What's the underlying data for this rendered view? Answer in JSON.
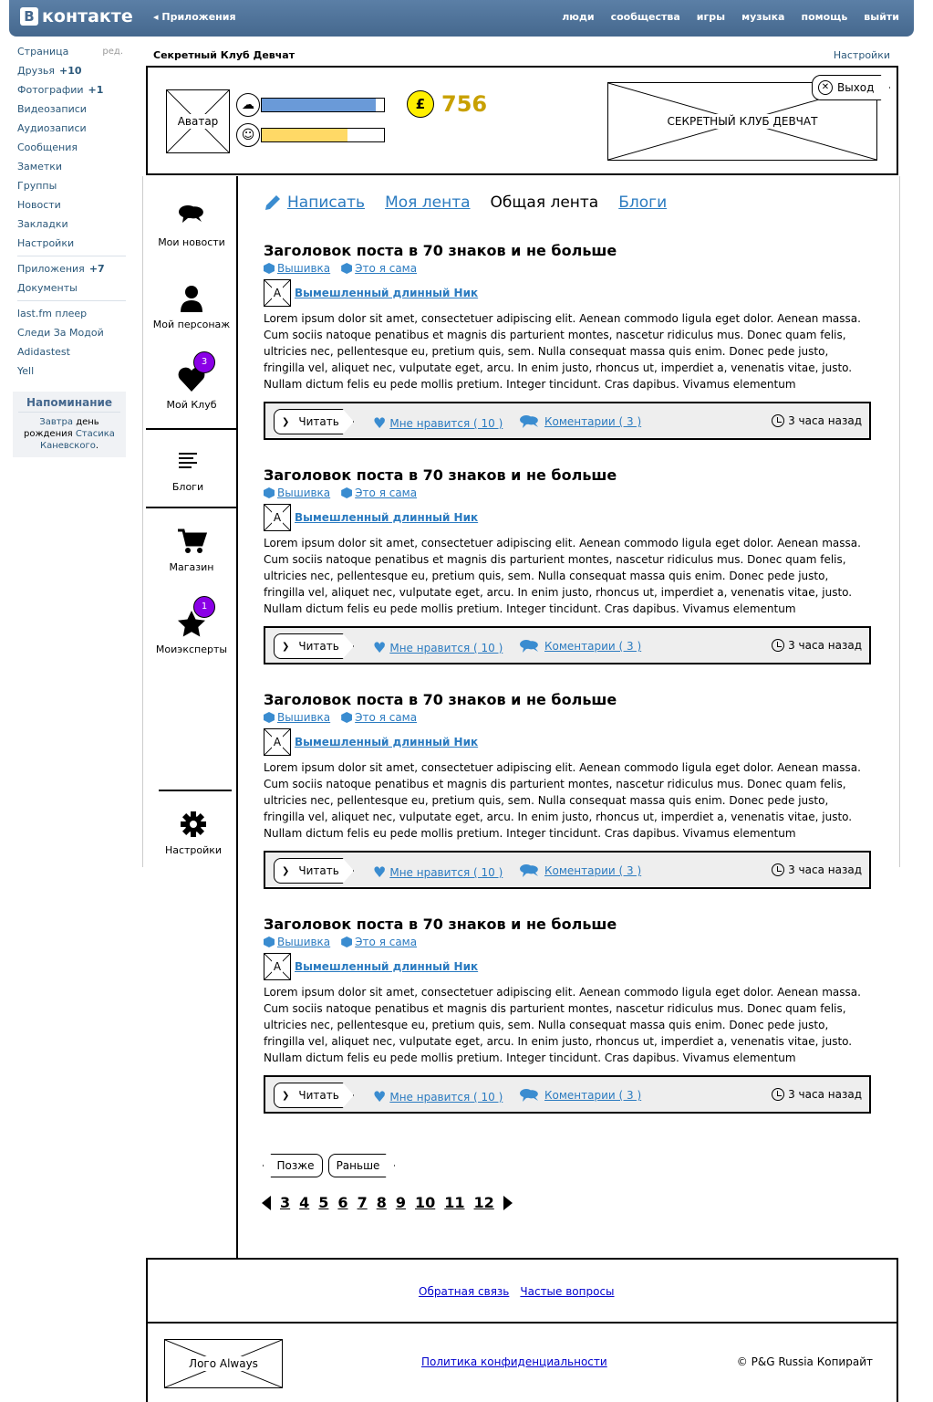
{
  "topbar": {
    "logo_b": "В",
    "logo_text": "контакте",
    "apps_link": "Приложения",
    "nav": [
      "люди",
      "сообщества",
      "игры",
      "музыка",
      "помощь",
      "выйти"
    ]
  },
  "leftmenu": {
    "edit": "ред.",
    "group1": [
      {
        "label": "Страница"
      },
      {
        "label": "Друзья",
        "count": "+10"
      },
      {
        "label": "Фотографии",
        "count": "+1"
      },
      {
        "label": "Видеозаписи"
      },
      {
        "label": "Аудиозаписи"
      },
      {
        "label": "Сообщения"
      },
      {
        "label": "Заметки"
      },
      {
        "label": "Группы"
      },
      {
        "label": "Новости"
      },
      {
        "label": "Закладки"
      },
      {
        "label": "Настройки"
      }
    ],
    "group2": [
      {
        "label": "Приложения",
        "count": "+7"
      },
      {
        "label": "Документы"
      }
    ],
    "group3": [
      {
        "label": "last.fm плеер"
      },
      {
        "label": "Следи За Модой"
      },
      {
        "label": "Adidastest"
      },
      {
        "label": "Yell"
      }
    ],
    "reminder": {
      "title": "Напоминание",
      "tomorrow": "Завтра",
      "text1": " день рождения ",
      "name": "Стасика Каневского",
      "dot": "."
    }
  },
  "header": {
    "title": "Секретный Клуб Девчат",
    "settings": "Настройки"
  },
  "profile": {
    "avatar": "Аватар",
    "bar1_level": 0.93,
    "bar2_level": 0.7,
    "coin_symbol": "£",
    "coins": "756",
    "club_banner": "СЕКРЕТНЫЙ КЛУБ ДЕВЧАТ",
    "exit": "Выход"
  },
  "sidenav": [
    {
      "label": "Мои новости",
      "icon": "chat-bubbles-icon"
    },
    {
      "label": "Мой персонаж",
      "icon": "person-icon"
    },
    {
      "label": "Мой Клуб",
      "icon": "heart-icon",
      "badge": "3"
    },
    {
      "label": "Блоги",
      "icon": "list-icon"
    },
    {
      "label": "Магазин",
      "icon": "cart-icon"
    },
    {
      "label": "Моиэксперты",
      "icon": "star-icon",
      "badge": "1"
    },
    {
      "label": "Настройки",
      "icon": "gear-icon"
    }
  ],
  "tabs": {
    "write": "Написать",
    "my_feed": "Моя лента",
    "common_feed": "Общая лента",
    "blogs": "Блоги"
  },
  "posts": [
    {
      "title": "Заголовок поста в 70 знаков и не больше",
      "tag1": "Вышивка",
      "tag2": "Это я сама",
      "avatar": "A",
      "nick": "Вымешленный длинный Ник",
      "body": "Lorem ipsum dolor sit amet, consectetuer adipiscing elit. Aenean commodo ligula eget dolor. Aenean massa. Cum sociis natoque penatibus et magnis dis parturient montes, nascetur ridiculus mus. Donec quam felis, ultricies nec, pellentesque eu, pretium quis, sem. Nulla consequat massa quis enim. Donec pede justo, fringilla vel, aliquet nec, vulputate eget, arcu. In enim justo, rhoncus ut, imperdiet a, venenatis vitae, justo. Nullam dictum felis eu pede mollis pretium. Integer tincidunt. Cras dapibus. Vivamus elementum",
      "read": "Читать",
      "like": "Мне нравится ( 10 )",
      "comments": "Коментарии ( 3 )",
      "time": "3 часа назад"
    },
    {
      "title": "Заголовок поста в 70 знаков и не больше",
      "tag1": "Вышивка",
      "tag2": "Это я сама",
      "avatar": "A",
      "nick": "Вымешленный длинный Ник",
      "body": "Lorem ipsum dolor sit amet, consectetuer adipiscing elit. Aenean commodo ligula eget dolor. Aenean massa. Cum sociis natoque penatibus et magnis dis parturient montes, nascetur ridiculus mus. Donec quam felis, ultricies nec, pellentesque eu, pretium quis, sem. Nulla consequat massa quis enim. Donec pede justo, fringilla vel, aliquet nec, vulputate eget, arcu. In enim justo, rhoncus ut, imperdiet a, venenatis vitae, justo. Nullam dictum felis eu pede mollis pretium. Integer tincidunt. Cras dapibus. Vivamus elementum",
      "read": "Читать",
      "like": "Мне нравится ( 10 )",
      "comments": "Коментарии ( 3 )",
      "time": "3 часа назад"
    },
    {
      "title": "Заголовок поста в 70 знаков и не больше",
      "tag1": "Вышивка",
      "tag2": "Это я сама",
      "avatar": "A",
      "nick": "Вымешленный длинный Ник",
      "body": "Lorem ipsum dolor sit amet, consectetuer adipiscing elit. Aenean commodo ligula eget dolor. Aenean massa. Cum sociis natoque penatibus et magnis dis parturient montes, nascetur ridiculus mus. Donec quam felis, ultricies nec, pellentesque eu, pretium quis, sem. Nulla consequat massa quis enim. Donec pede justo, fringilla vel, aliquet nec, vulputate eget, arcu. In enim justo, rhoncus ut, imperdiet a, venenatis vitae, justo. Nullam dictum felis eu pede mollis pretium. Integer tincidunt. Cras dapibus. Vivamus elementum",
      "read": "Читать",
      "like": "Мне нравится ( 10 )",
      "comments": "Коментарии ( 3 )",
      "time": "3 часа назад"
    },
    {
      "title": "Заголовок поста в 70 знаков и не больше",
      "tag1": "Вышивка",
      "tag2": "Это я сама",
      "avatar": "A",
      "nick": "Вымешленный длинный Ник",
      "body": "Lorem ipsum dolor sit amet, consectetuer adipiscing elit. Aenean commodo ligula eget dolor. Aenean massa. Cum sociis natoque penatibus et magnis dis parturient montes, nascetur ridiculus mus. Donec quam felis, ultricies nec, pellentesque eu, pretium quis, sem. Nulla consequat massa quis enim. Donec pede justo, fringilla vel, aliquet nec, vulputate eget, arcu. In enim justo, rhoncus ut, imperdiet a, venenatis vitae, justo. Nullam dictum felis eu pede mollis pretium. Integer tincidunt. Cras dapibus. Vivamus elementum",
      "read": "Читать",
      "like": "Мне нравится ( 10 )",
      "comments": "Коментарии ( 3 )",
      "time": "3 часа назад"
    }
  ],
  "pager": {
    "later": "Позже",
    "earlier": "Раньше",
    "pages": [
      "3",
      "4",
      "5",
      "6",
      "7",
      "8",
      "9",
      "10",
      "11",
      "12"
    ]
  },
  "footer": {
    "feedback": "Обратная связь",
    "faq": "Частые вопросы",
    "logo": "Лого Always",
    "privacy": "Политика конфиденциальности",
    "copyright": "© P&G Russia Копирайт"
  },
  "colors": {
    "vk_blue": "#45688e",
    "link": "#2b7bc0",
    "badge": "#8a00e6",
    "coin": "#ffef00",
    "bar1": "#6a9ad8",
    "bar2": "#ffd966"
  }
}
